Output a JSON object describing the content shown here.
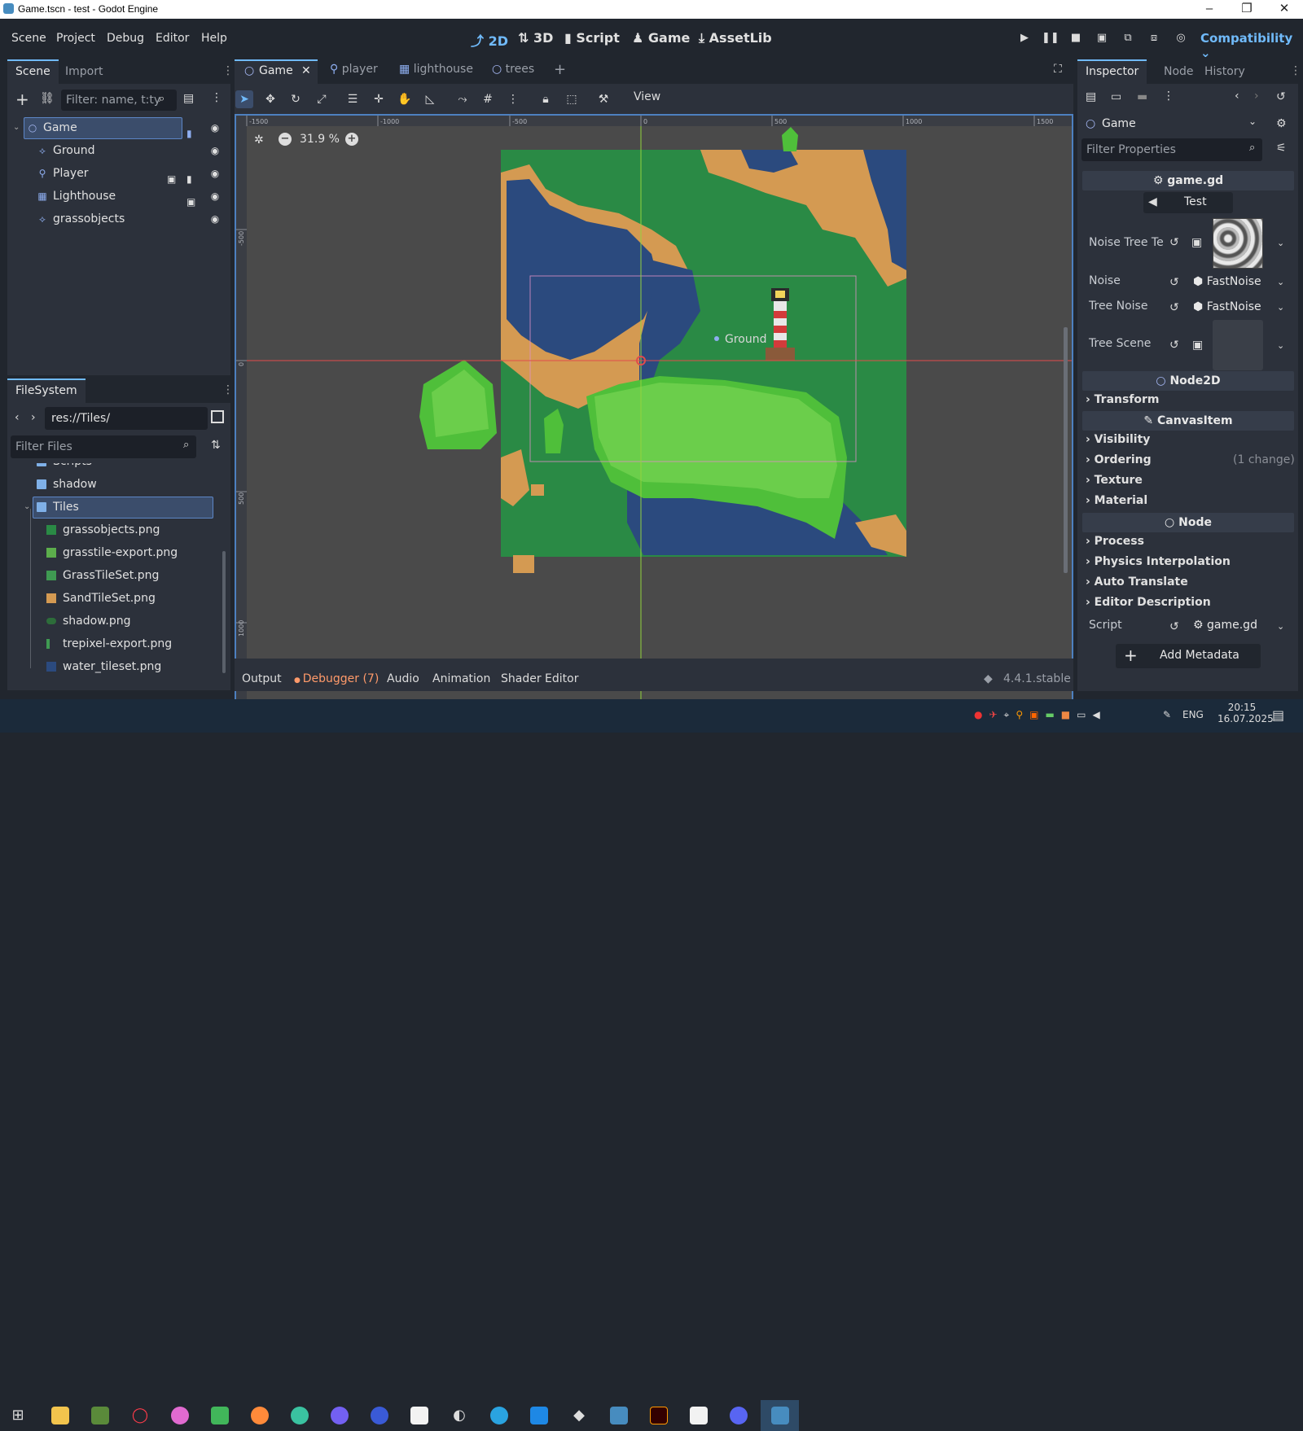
{
  "window": {
    "title": "Game.tscn - test - Godot Engine"
  },
  "menu": [
    "Scene",
    "Project",
    "Debug",
    "Editor",
    "Help"
  ],
  "workspaces": [
    {
      "icon": "2d-icon",
      "label": "2D",
      "active": true
    },
    {
      "icon": "3d-icon",
      "label": "3D"
    },
    {
      "icon": "script-icon",
      "label": "Script"
    },
    {
      "icon": "game-icon",
      "label": "Game"
    },
    {
      "icon": "assetlib-icon",
      "label": "AssetLib"
    }
  ],
  "renderer": "Compatibility",
  "scene_panel": {
    "tabs": [
      "Scene",
      "Import"
    ],
    "filter_placeholder": "Filter: name, t:ty",
    "nodes": [
      {
        "name": "Game",
        "icon": "node2d-icon",
        "selected": true
      },
      {
        "name": "Ground",
        "icon": "tilemap-icon"
      },
      {
        "name": "Player",
        "icon": "player-icon"
      },
      {
        "name": "Lighthouse",
        "icon": "lighthouse-icon"
      },
      {
        "name": "grassobjects",
        "icon": "tilemap-icon"
      }
    ]
  },
  "filesystem": {
    "title": "FileSystem",
    "path": "res://Tiles/",
    "filter_placeholder": "Filter Files",
    "items": [
      {
        "name": "Scripts",
        "type": "folder"
      },
      {
        "name": "shadow",
        "type": "folder"
      },
      {
        "name": "Tiles",
        "type": "folder",
        "selected": true
      },
      {
        "name": "grassobjects.png",
        "type": "image"
      },
      {
        "name": "grasstile-export.png",
        "type": "image"
      },
      {
        "name": "GrassTileSet.png",
        "type": "image"
      },
      {
        "name": "SandTileSet.png",
        "type": "image"
      },
      {
        "name": "shadow.png",
        "type": "image"
      },
      {
        "name": "trepixel-export.png",
        "type": "image"
      },
      {
        "name": "water_tileset.png",
        "type": "image"
      }
    ]
  },
  "editor_tabs": [
    "Game",
    "player",
    "lighthouse",
    "trees"
  ],
  "toolbar": {
    "view_label": "View"
  },
  "viewport": {
    "zoom": "31.9 %",
    "ruler_x": [
      "-1500",
      "-1000",
      "-500",
      "0",
      "500",
      "1000",
      "1500"
    ],
    "ruler_y": [
      "-500",
      "0",
      "500",
      "1000"
    ],
    "ground_label": "Ground"
  },
  "bottom_panel": {
    "tabs": [
      "Output",
      "Debugger (7)",
      "Audio",
      "Animation",
      "Shader Editor"
    ],
    "version": "4.4.1.stable"
  },
  "inspector": {
    "tabs": [
      "Inspector",
      "Node",
      "History"
    ],
    "node": "Game",
    "filter_placeholder": "Filter Properties",
    "script_header": "game.gd",
    "test_button": "Test",
    "props": [
      {
        "label": "Noise Tree Te",
        "value": ""
      },
      {
        "label": "Noise",
        "value": "FastNoise"
      },
      {
        "label": "Tree Noise",
        "value": "FastNoise"
      },
      {
        "label": "Tree Scene",
        "value": ""
      }
    ],
    "sections": {
      "node2d": "Node2D",
      "transform": "Transform",
      "canvasitem": "CanvasItem",
      "visibility": "Visibility",
      "ordering": "Ordering",
      "ordering_note": "(1 change)",
      "texture": "Texture",
      "material": "Material",
      "node": "Node",
      "process": "Process",
      "physics": "Physics Interpolation",
      "auto_translate": "Auto Translate",
      "editor_desc": "Editor Description"
    },
    "script_label": "Script",
    "script_value": "game.gd",
    "add_metadata": "Add Metadata"
  },
  "taskbar": {
    "language": "ENG",
    "time": "20:15",
    "date": "16.07.2025"
  },
  "colors": {
    "accent": "#70bafa",
    "grass": "#2a8a45",
    "water": "#2b4a7e",
    "sand": "#d49a52",
    "canvas": "#4a4a4a"
  }
}
